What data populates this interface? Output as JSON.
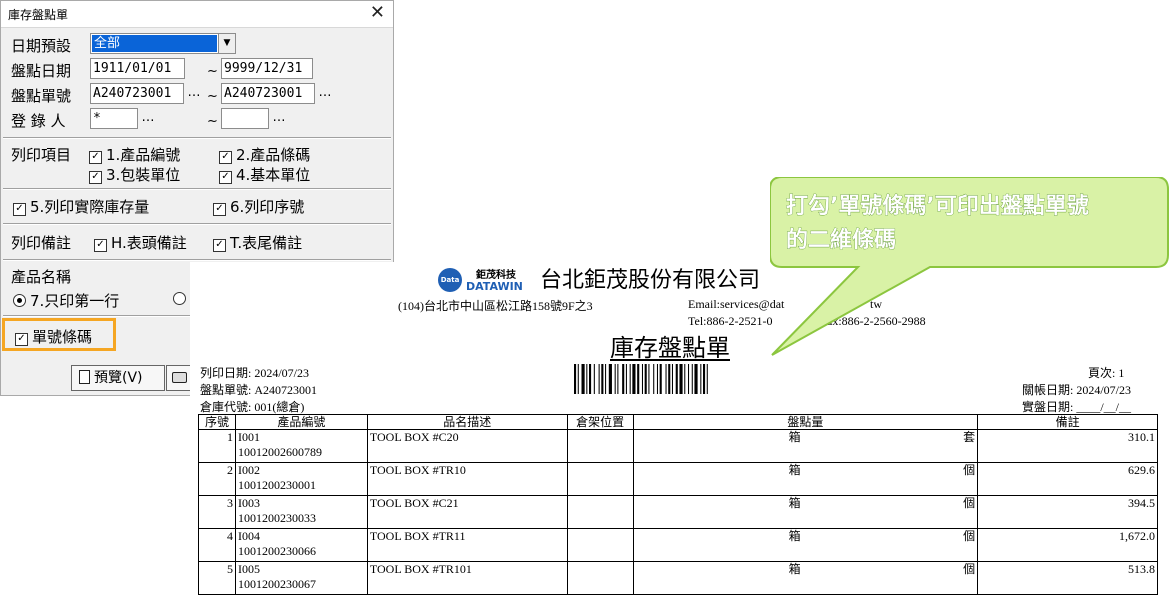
{
  "dialog": {
    "title": "庫存盤點單",
    "close_glyph": "✕",
    "date_preset": {
      "label": "日期預設",
      "value": "全部"
    },
    "count_date": {
      "label": "盤點日期",
      "from": "1911/01/01",
      "to": "9999/12/31"
    },
    "count_no": {
      "label": "盤點單號",
      "from": "A240723001",
      "to": "A240723001"
    },
    "registrant": {
      "label": "登 錄 人",
      "from": "*",
      "to": ""
    },
    "tilde": "~",
    "ellipsis": "…",
    "print_items": {
      "label": "列印項目",
      "options": [
        {
          "text": "1.產品編號",
          "checked": true
        },
        {
          "text": "2.產品條碼",
          "checked": true
        },
        {
          "text": "3.包裝單位",
          "checked": true
        },
        {
          "text": "4.基本單位",
          "checked": true
        }
      ]
    },
    "print_actual_stock": {
      "text": "5.列印實際庫存量",
      "checked": true
    },
    "print_serial": {
      "text": "6.列印序號",
      "checked": true
    },
    "print_notes": {
      "label": "列印備註",
      "header_note": {
        "text": "H.表頭備註",
        "checked": true
      },
      "footer_note": {
        "text": "T.表尾備註",
        "checked": true
      }
    },
    "product_name": {
      "label": "產品名稱",
      "first_line_only": "7.只印第一行",
      "first_line_selected": true
    },
    "barcode_option": {
      "text": "單號條碼",
      "checked": true
    },
    "preview_button": "預覽(V)",
    "check_glyph": "✓",
    "dropdown_glyph": "▼"
  },
  "report": {
    "logo_cn": "鉅茂科技",
    "logo_en": "DATAWIN",
    "logo_mark": "Data",
    "company": "台北鉅茂股份有限公司",
    "address": "(104)台北市中山區松江路158號9F之3",
    "email_line": "Email:services@dat",
    "email_tail": "tw",
    "tel_line": "Tel:886-2-2521-0",
    "fax_line": "ax:886-2-2560-2988",
    "doc_title": "庫存盤點單",
    "print_date": "列印日期: 2024/07/23",
    "count_no": "盤點單號: A240723001",
    "warehouse": "倉庫代號: 001(總倉)",
    "page": "頁次:      1",
    "close_date": "關帳日期: 2024/07/23",
    "actual_date": "實盤日期: ____/__/__",
    "columns": [
      "序號",
      "產品編號",
      "品名描述",
      "倉架位置",
      "盤點量",
      "備註"
    ],
    "rows": [
      {
        "no": "1",
        "code": "I001",
        "barcode": "10012002600789",
        "desc": "TOOL BOX #C20",
        "unit1": "箱",
        "unit2": "套",
        "qty": "310.1"
      },
      {
        "no": "2",
        "code": "I002",
        "barcode": "1001200230001",
        "desc": "TOOL BOX #TR10",
        "unit1": "箱",
        "unit2": "個",
        "qty": "629.6"
      },
      {
        "no": "3",
        "code": "I003",
        "barcode": "1001200230033",
        "desc": "TOOL BOX #C21",
        "unit1": "箱",
        "unit2": "個",
        "qty": "394.5"
      },
      {
        "no": "4",
        "code": "I004",
        "barcode": "1001200230066",
        "desc": "TOOL BOX #TR11",
        "unit1": "箱",
        "unit2": "個",
        "qty": "1,672.0"
      },
      {
        "no": "5",
        "code": "I005",
        "barcode": "1001200230067",
        "desc": "TOOL BOX #TR101",
        "unit1": "箱",
        "unit2": "個",
        "qty": "513.8"
      }
    ]
  },
  "callout": {
    "line1": "打勾’單號條碼’可印出盤點單號",
    "line2": "的二維條碼"
  },
  "colors": {
    "highlight_border": "#f5a623",
    "callout_fill": "#d9f2a6",
    "callout_border": "#8cc63f",
    "selection_bg": "#0a64d8"
  }
}
